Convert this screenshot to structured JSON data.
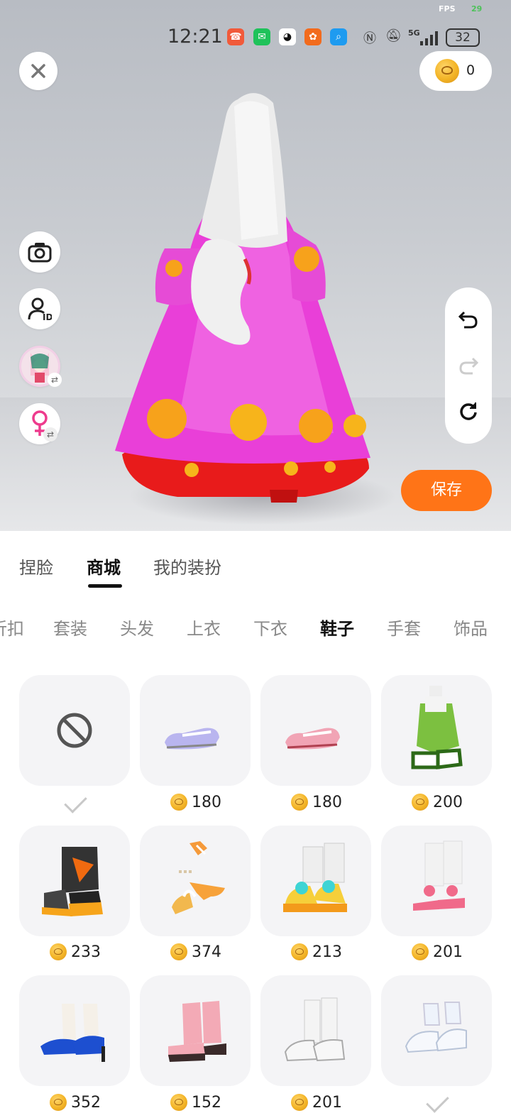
{
  "status_bar": {
    "fps_label": "FPS",
    "fps_value": "29",
    "time": "12:21",
    "network": "5G",
    "battery": "32"
  },
  "header": {
    "coin_balance": "0"
  },
  "actions": {
    "save_label": "保存"
  },
  "tabs": [
    {
      "label": "捏脸",
      "active": false
    },
    {
      "label": "商城",
      "active": true
    },
    {
      "label": "我的装扮",
      "active": false
    }
  ],
  "categories": [
    {
      "label": "折扣",
      "active": false
    },
    {
      "label": "套装",
      "active": false
    },
    {
      "label": "头发",
      "active": false
    },
    {
      "label": "上衣",
      "active": false
    },
    {
      "label": "下衣",
      "active": false
    },
    {
      "label": "鞋子",
      "active": true
    },
    {
      "label": "手套",
      "active": false
    },
    {
      "label": "饰品",
      "active": false
    }
  ],
  "items": [
    {
      "name": "none",
      "price": "",
      "selected": true
    },
    {
      "name": "lavender-mary-jane-shoes",
      "price": "180",
      "selected": false
    },
    {
      "name": "pink-mary-jane-shoes",
      "price": "180",
      "selected": false
    },
    {
      "name": "green-leg-warmers",
      "price": "200",
      "selected": false
    },
    {
      "name": "orange-tech-boots",
      "price": "233",
      "selected": false
    },
    {
      "name": "orange-ribbon-sandals",
      "price": "374",
      "selected": false
    },
    {
      "name": "yellow-sneakers",
      "price": "213",
      "selected": false
    },
    {
      "name": "pink-bow-sandals",
      "price": "201",
      "selected": false
    },
    {
      "name": "blue-heels",
      "price": "352",
      "selected": false
    },
    {
      "name": "pink-lace-boots",
      "price": "152",
      "selected": false
    },
    {
      "name": "white-socks-sneakers",
      "price": "201",
      "selected": false
    },
    {
      "name": "white-ruffle-shoes",
      "price": "",
      "selected": true
    }
  ]
}
